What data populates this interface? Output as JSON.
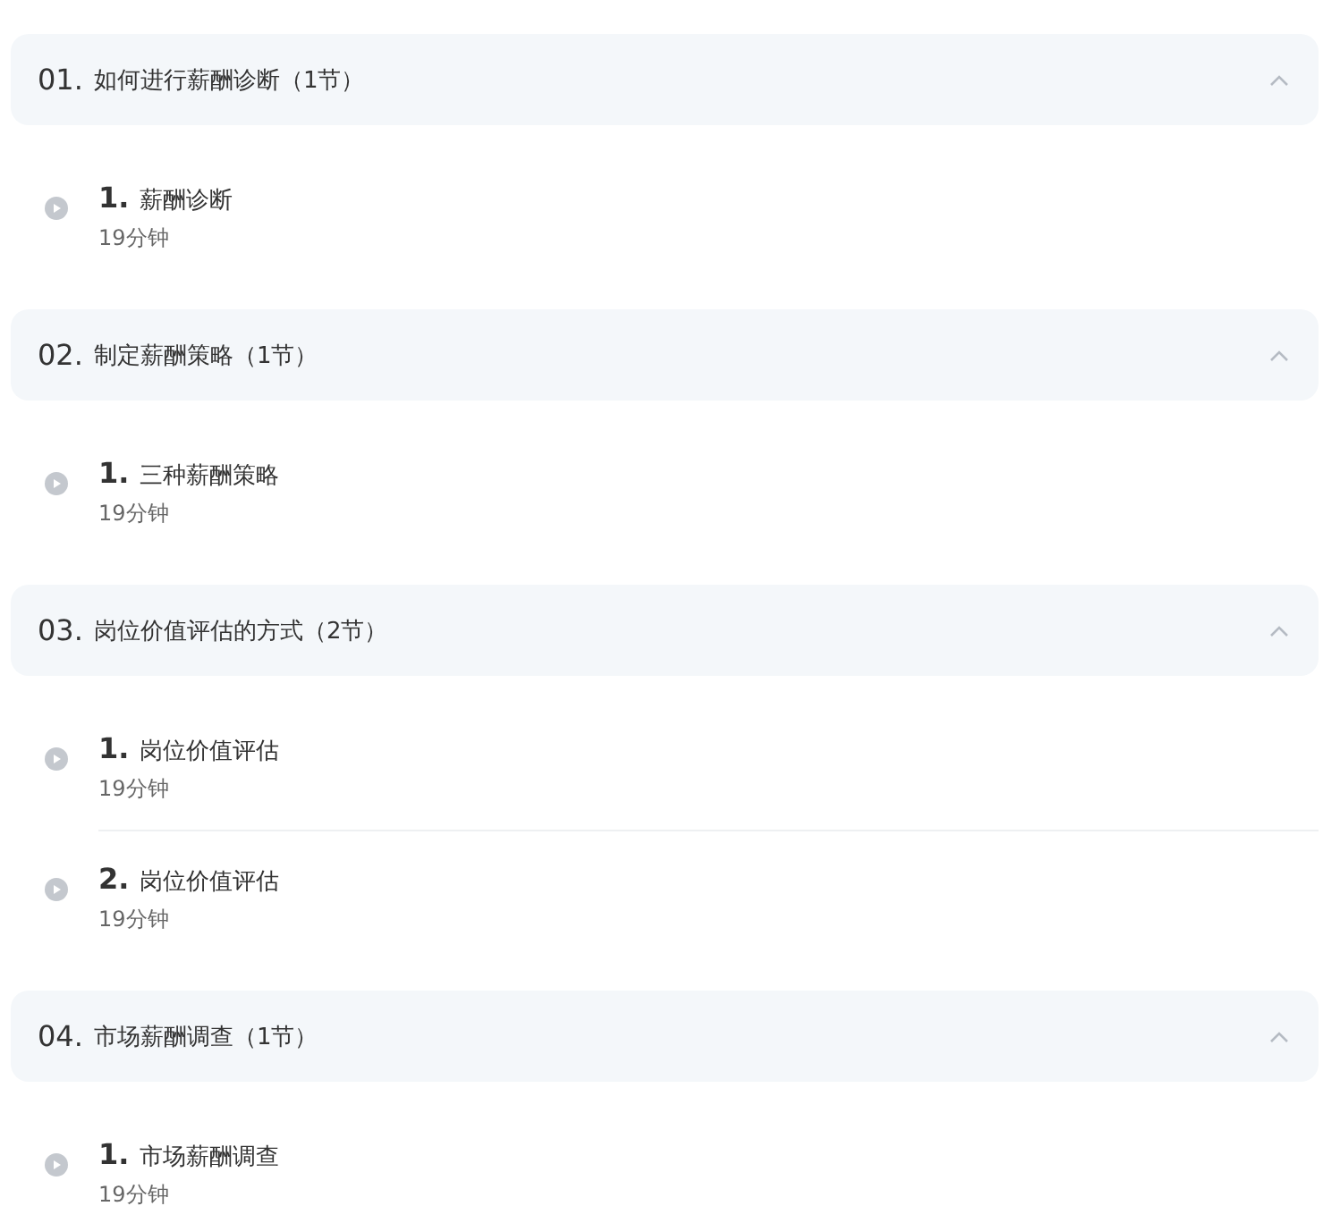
{
  "sections": [
    {
      "number": "01.",
      "title": "如何进行薪酬诊断（1节）",
      "expanded": true,
      "lessons": [
        {
          "number": "1.",
          "title": "薪酬诊断",
          "duration": "19分钟"
        }
      ]
    },
    {
      "number": "02.",
      "title": "制定薪酬策略（1节）",
      "expanded": true,
      "lessons": [
        {
          "number": "1.",
          "title": "三种薪酬策略",
          "duration": "19分钟"
        }
      ]
    },
    {
      "number": "03.",
      "title": "岗位价值评估的方式（2节）",
      "expanded": true,
      "lessons": [
        {
          "number": "1.",
          "title": "岗位价值评估",
          "duration": "19分钟"
        },
        {
          "number": "2.",
          "title": "岗位价值评估",
          "duration": "19分钟"
        }
      ]
    },
    {
      "number": "04.",
      "title": "市场薪酬调查（1节）",
      "expanded": true,
      "lessons": [
        {
          "number": "1.",
          "title": "市场薪酬调查",
          "duration": "19分钟"
        }
      ]
    }
  ]
}
